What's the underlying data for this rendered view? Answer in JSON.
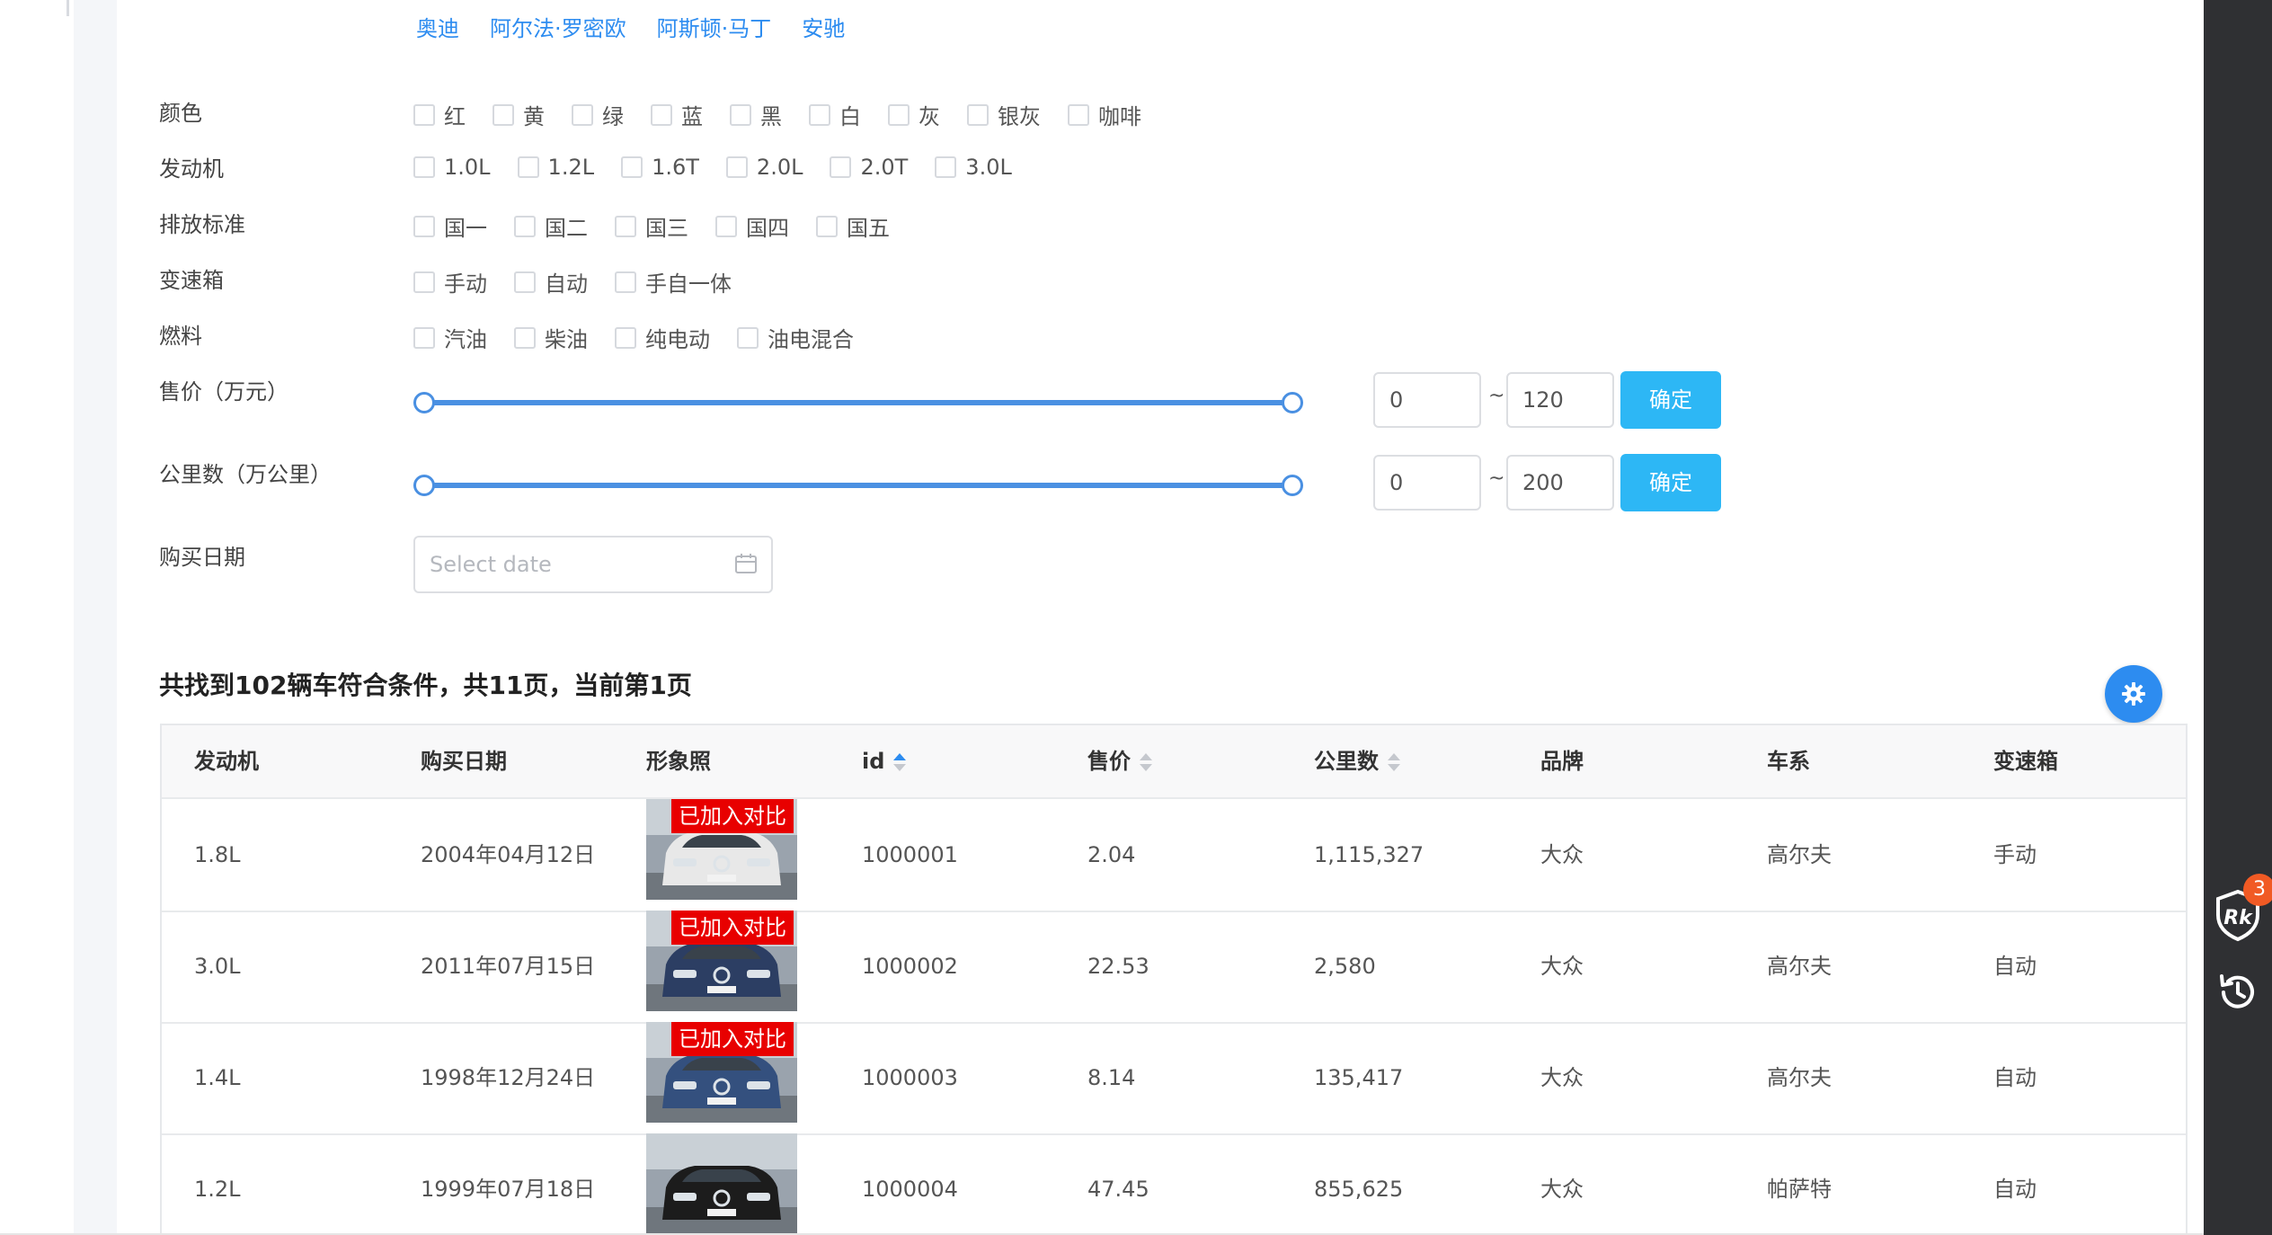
{
  "brands": [
    "奥迪",
    "阿尔法·罗密欧",
    "阿斯顿·马丁",
    "安驰"
  ],
  "filters": {
    "color": {
      "label": "颜色",
      "options": [
        "红",
        "黄",
        "绿",
        "蓝",
        "黑",
        "白",
        "灰",
        "银灰",
        "咖啡"
      ]
    },
    "engine": {
      "label": "发动机",
      "options": [
        "1.0L",
        "1.2L",
        "1.6T",
        "2.0L",
        "2.0T",
        "3.0L"
      ]
    },
    "emission": {
      "label": "排放标准",
      "options": [
        "国一",
        "国二",
        "国三",
        "国四",
        "国五"
      ]
    },
    "gearbox": {
      "label": "变速箱",
      "options": [
        "手动",
        "自动",
        "手自一体"
      ]
    },
    "fuel": {
      "label": "燃料",
      "options": [
        "汽油",
        "柴油",
        "纯电动",
        "油电混合"
      ]
    }
  },
  "price": {
    "label": "售价（万元）",
    "min": "0",
    "max": "120",
    "tilde": "~",
    "confirm": "确定",
    "range_fraction": [
      0,
      1
    ]
  },
  "mileage": {
    "label": "公里数（万公里）",
    "min": "0",
    "max": "200",
    "tilde": "~",
    "confirm": "确定",
    "range_fraction": [
      0,
      1
    ]
  },
  "purchase_date": {
    "label": "购买日期",
    "placeholder": "Select date"
  },
  "result_summary": "共找到102辆车符合条件，共11页，当前第1页",
  "table": {
    "headers": {
      "engine": "发动机",
      "date": "购买日期",
      "photo": "形象照",
      "id": "id",
      "price": "售价",
      "km": "公里数",
      "brand": "品牌",
      "series": "车系",
      "gearbox": "变速箱"
    },
    "compare_tag": "已加入对比",
    "rows": [
      {
        "engine": "1.8L",
        "date": "2004年04月12日",
        "id": "1000001",
        "price": "2.04",
        "km": "1,115,327",
        "brand": "大众",
        "series": "高尔夫",
        "gearbox": "手动",
        "compared": true,
        "car_color": "#e8e8e8"
      },
      {
        "engine": "3.0L",
        "date": "2011年07月15日",
        "id": "1000002",
        "price": "22.53",
        "km": "2,580",
        "brand": "大众",
        "series": "高尔夫",
        "gearbox": "自动",
        "compared": true,
        "car_color": "#2c3e63"
      },
      {
        "engine": "1.4L",
        "date": "1998年12月24日",
        "id": "1000003",
        "price": "8.14",
        "km": "135,417",
        "brand": "大众",
        "series": "高尔夫",
        "gearbox": "自动",
        "compared": true,
        "car_color": "#34507e"
      },
      {
        "engine": "1.2L",
        "date": "1999年07月18日",
        "id": "1000004",
        "price": "47.45",
        "km": "855,625",
        "brand": "大众",
        "series": "帕萨特",
        "gearbox": "自动",
        "compared": false,
        "car_color": "#1c1c1c"
      }
    ]
  },
  "sidebar": {
    "badge_count": "3",
    "rk_icon": "rk-shield-icon",
    "history_icon": "history-icon"
  },
  "colors": {
    "accent": "#2d8cf0",
    "confirm_btn": "#2db7f5",
    "compare_tag": "#e80000",
    "badge": "#f15a24"
  }
}
